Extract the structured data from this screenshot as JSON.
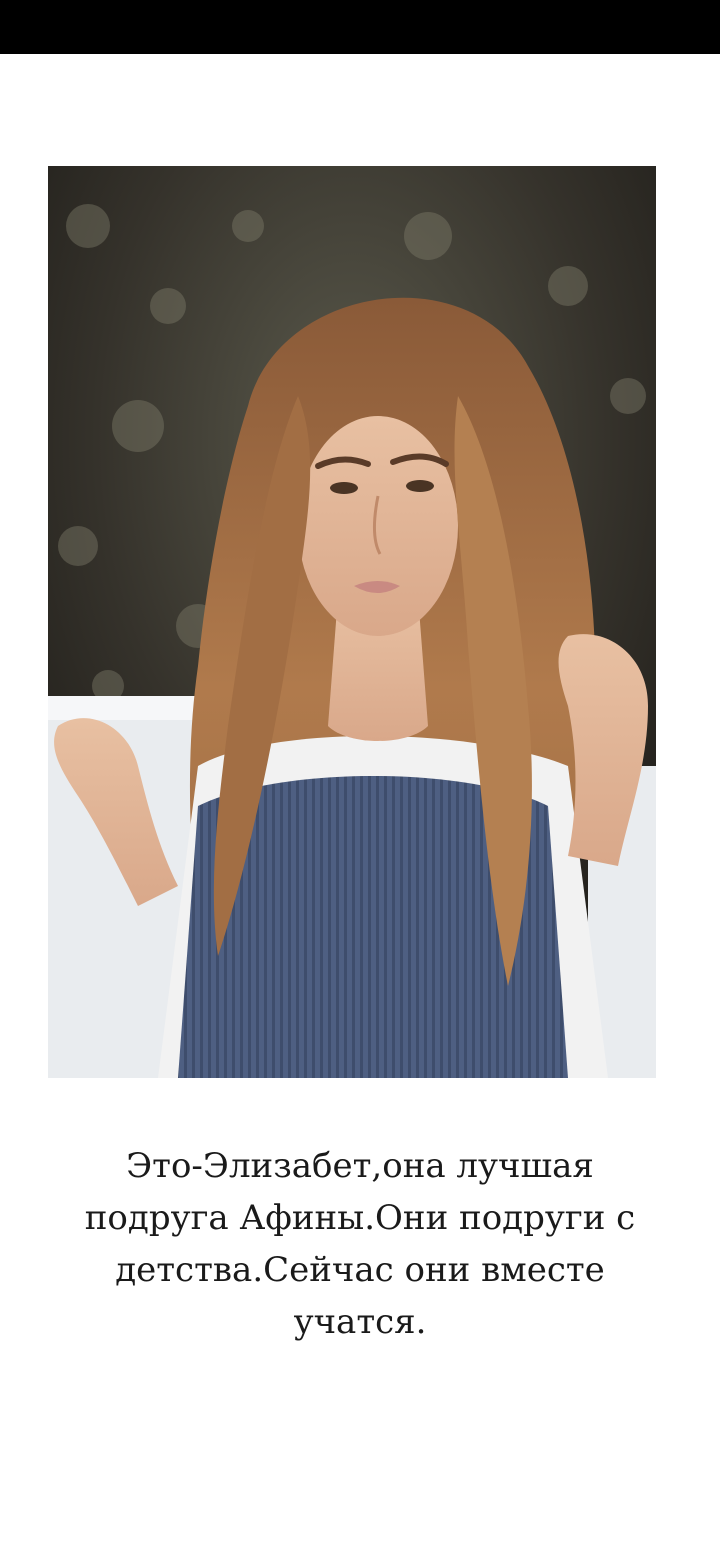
{
  "photo": {
    "subject": "portrait-of-young-woman-with-long-wavy-hair"
  },
  "story": {
    "caption": "Это-Элизабет,она лучшая подруга Афины.Они подруги с детства.Сейчас они вместе учатся."
  },
  "colors": {
    "status_bar": "#000000",
    "background": "#ffffff",
    "text": "#1a1a1a"
  }
}
